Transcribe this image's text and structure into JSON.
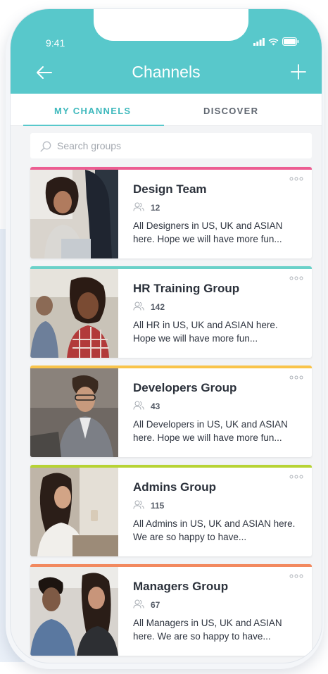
{
  "status": {
    "time": "9:41"
  },
  "header": {
    "title": "Channels",
    "accent": "#58c8cb"
  },
  "tabs": [
    {
      "label": "MY CHANNELS",
      "active": true
    },
    {
      "label": "DISCOVER",
      "active": false
    }
  ],
  "search": {
    "placeholder": "Search groups",
    "value": ""
  },
  "channels": [
    {
      "name": "Design Team",
      "members": "12",
      "description": "All Designers in US, UK and ASIAN here. Hope we will have more fun...",
      "color": "#ec5d92",
      "icon": "people-icon"
    },
    {
      "name": "HR Training Group",
      "members": "142",
      "description": "All HR in US, UK and ASIAN here. Hope we will have more fun...",
      "color": "#6ad1c9",
      "icon": "people-icon"
    },
    {
      "name": "Developers Group",
      "members": "43",
      "description": "All Developers in US, UK and ASIAN here. Hope we will have more fun...",
      "color": "#f9c44a",
      "icon": "people-icon"
    },
    {
      "name": "Admins Group",
      "members": "115",
      "description": "All Admins in US, UK and ASIAN here. We are so happy to have...",
      "color": "#b7d334",
      "icon": "people-icon"
    },
    {
      "name": "Managers Group",
      "members": "67",
      "description": "All Managers in US, UK and ASIAN here. We are so happy to have...",
      "color": "#f2895f",
      "icon": "people-icon"
    }
  ]
}
